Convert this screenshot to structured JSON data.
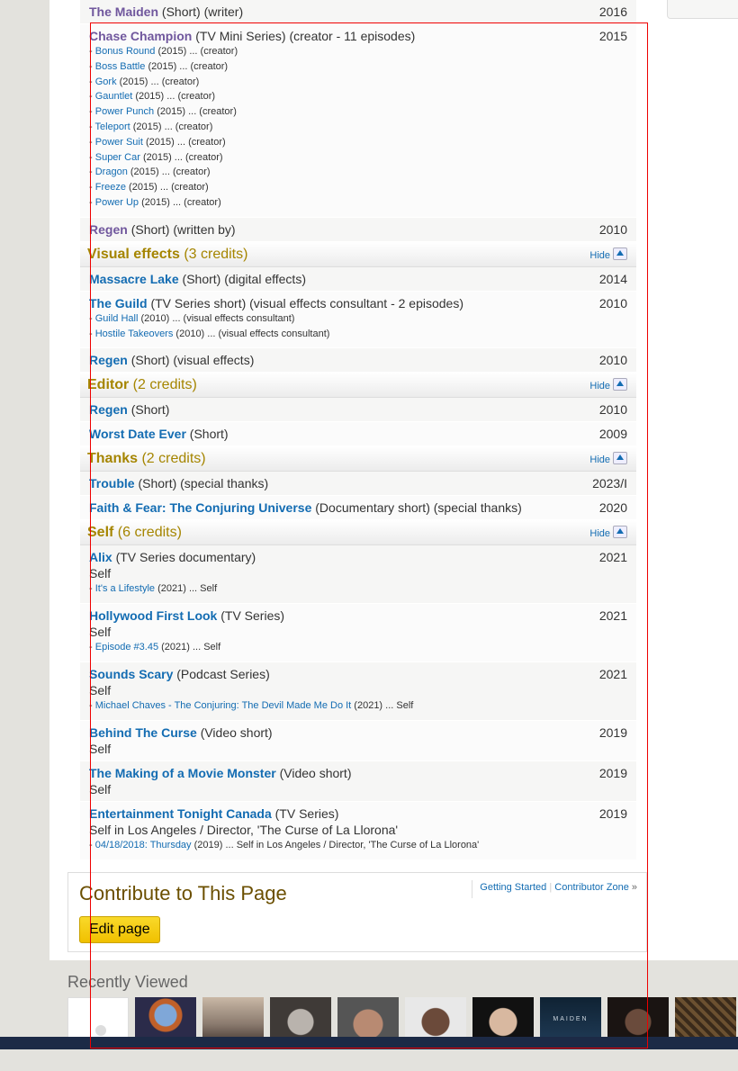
{
  "filmography": {
    "writer_tail": [
      {
        "title": "The Maiden",
        "details": "(Short) (writer)",
        "year": "2016"
      },
      {
        "title": "Chase Champion",
        "details": "(TV Mini Series) (creator - 11 episodes)",
        "year": "2015",
        "episodes": [
          {
            "title": "Bonus Round",
            "rest": "(2015) ... (creator)"
          },
          {
            "title": "Boss Battle",
            "rest": "(2015) ... (creator)"
          },
          {
            "title": "Gork",
            "rest": "(2015) ... (creator)"
          },
          {
            "title": "Gauntlet",
            "rest": "(2015) ... (creator)"
          },
          {
            "title": "Power Punch",
            "rest": "(2015) ... (creator)"
          },
          {
            "title": "Teleport",
            "rest": "(2015) ... (creator)"
          },
          {
            "title": "Power Suit",
            "rest": "(2015) ... (creator)"
          },
          {
            "title": "Super Car",
            "rest": "(2015) ... (creator)"
          },
          {
            "title": "Dragon",
            "rest": "(2015) ... (creator)"
          },
          {
            "title": "Freeze",
            "rest": "(2015) ... (creator)"
          },
          {
            "title": "Power Up",
            "rest": "(2015) ... (creator)"
          }
        ]
      },
      {
        "title": "Regen",
        "details": "(Short) (written by)",
        "year": "2010"
      }
    ],
    "visual_effects": {
      "heading": "Visual effects",
      "count": "(3 credits)",
      "hide": "Hide",
      "rows": [
        {
          "title": "Massacre Lake",
          "details": "(Short) (digital effects)",
          "year": "2014"
        },
        {
          "title": "The Guild",
          "details": "(TV Series short) (visual effects consultant - 2 episodes)",
          "year": "2010",
          "episodes": [
            {
              "title": "Guild Hall",
              "rest": "(2010) ... (visual effects consultant)"
            },
            {
              "title": "Hostile Takeovers",
              "rest": "(2010) ... (visual effects consultant)"
            }
          ]
        },
        {
          "title": "Regen",
          "details": "(Short) (visual effects)",
          "year": "2010"
        }
      ]
    },
    "editor": {
      "heading": "Editor",
      "count": "(2 credits)",
      "hide": "Hide",
      "rows": [
        {
          "title": "Regen",
          "details": "(Short)",
          "year": "2010"
        },
        {
          "title": "Worst Date Ever",
          "details": "(Short)",
          "year": "2009"
        }
      ]
    },
    "thanks": {
      "heading": "Thanks",
      "count": "(2 credits)",
      "hide": "Hide",
      "rows": [
        {
          "title": "Trouble",
          "details": "(Short) (special thanks)",
          "year": "2023/I"
        },
        {
          "title": "Faith & Fear: The Conjuring Universe",
          "details": "(Documentary short) (special thanks)",
          "year": "2020"
        }
      ]
    },
    "self": {
      "heading": "Self",
      "count": "(6 credits)",
      "hide": "Hide",
      "rows": [
        {
          "title": "Alix",
          "details": "(TV Series documentary)",
          "year": "2021",
          "role": "Self",
          "episodes": [
            {
              "title": "It's a Lifestyle",
              "rest": "(2021) ... Self"
            }
          ]
        },
        {
          "title": "Hollywood First Look",
          "details": "(TV Series)",
          "year": "2021",
          "role": "Self",
          "episodes": [
            {
              "title": "Episode #3.45",
              "rest": "(2021) ... Self"
            }
          ]
        },
        {
          "title": "Sounds Scary",
          "details": "(Podcast Series)",
          "year": "2021",
          "role": "Self",
          "episodes": [
            {
              "title": "Michael Chaves - The Conjuring: The Devil Made Me Do It",
              "rest": "(2021) ... Self"
            }
          ]
        },
        {
          "title": "Behind The Curse",
          "details": "(Video short)",
          "year": "2019",
          "role": "Self"
        },
        {
          "title": "The Making of a Movie Monster",
          "details": "(Video short)",
          "year": "2019",
          "role": "Self"
        },
        {
          "title": "Entertainment Tonight Canada",
          "details": "(TV Series)",
          "year": "2019",
          "role": "Self in Los Angeles / Director, 'The Curse of La Llorona'",
          "episodes": [
            {
              "title": "04/18/2018: Thursday",
              "rest": "(2019) ... Self in Los Angeles / Director, 'The Curse of La Llorona'"
            }
          ]
        }
      ]
    }
  },
  "contribute": {
    "title": "Contribute to This Page",
    "getting_started": "Getting Started",
    "contributor_zone": "Contributor Zone",
    "edit_button": "Edit page"
  },
  "recently_viewed": {
    "title": "Recently Viewed",
    "thumb_labels": [
      "MAIDEN"
    ]
  }
}
